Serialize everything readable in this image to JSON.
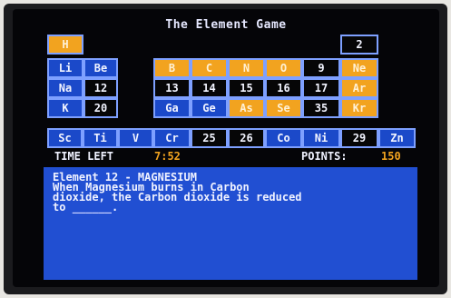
{
  "title": "The Element Game",
  "colors": {
    "blue_cell": "#1b49c9",
    "orange_cell": "#f2a31f",
    "black_cell": "#060607",
    "timer": "#f2a31f",
    "message_bg": "#214fd2"
  },
  "cells": {
    "H": "H",
    "He": "2",
    "Li": "Li",
    "Be": "Be",
    "B": "B",
    "C": "C",
    "N": "N",
    "O": "O",
    "F": "9",
    "Ne": "Ne",
    "Na": "Na",
    "Mg": "12",
    "Al": "13",
    "Si": "14",
    "P": "15",
    "S": "16",
    "Cl": "17",
    "Ar": "Ar",
    "K": "K",
    "Ca": "20",
    "Ga": "Ga",
    "Ge": "Ge",
    "As": "As",
    "Se": "Se",
    "Br": "35",
    "Kr": "Kr",
    "Sc": "Sc",
    "Ti": "Ti",
    "V": "V",
    "Cr": "Cr",
    "Mn": "25",
    "Fe": "26",
    "Co": "Co",
    "Ni": "Ni",
    "Cu": "29",
    "Zn": "Zn"
  },
  "status": {
    "time_label": "TIME LEFT",
    "time_value": "7:52",
    "points_label": "POINTS:",
    "points_value": "150"
  },
  "message": {
    "header": "Element 12 - MAGNESIUM",
    "line1": "When Magnesium burns in Carbon",
    "line2": "dioxide, the Carbon dioxide is reduced",
    "line3_prefix": "to ",
    "blank": "______",
    "line3_suffix": "."
  }
}
